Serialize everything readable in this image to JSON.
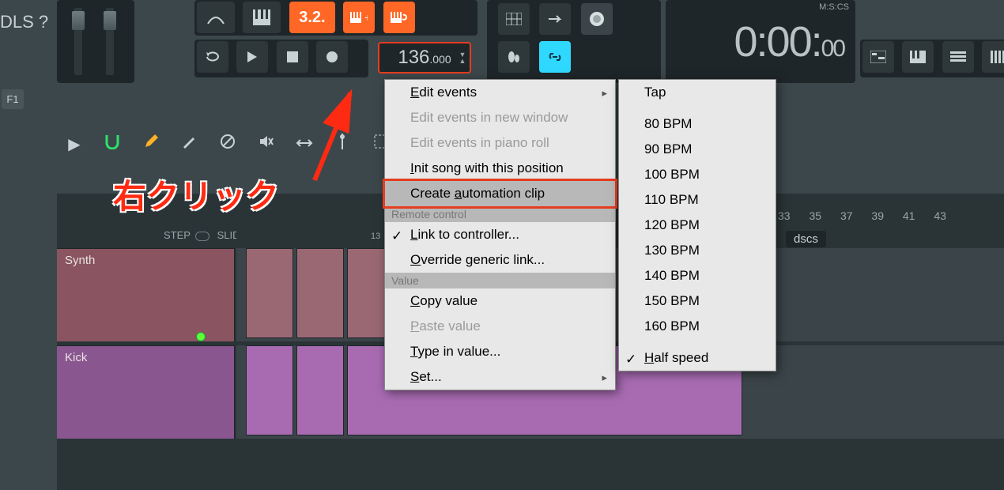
{
  "left": {
    "ols_text": "DLS ?",
    "f1": "F1"
  },
  "toolbar": {
    "pattern_num": "3.2.",
    "tempo_main": "136",
    "tempo_dec": ".000",
    "time_label": "M:S:CS",
    "time": "0:00:",
    "time_cs": "00"
  },
  "toolrow": {
    "step": "STEP",
    "slide": "SLIDE"
  },
  "timeline": {
    "nums": [
      "13",
      "33",
      "35",
      "37",
      "39",
      "41",
      "43"
    ]
  },
  "tracks": {
    "synth": "Synth",
    "kick": "Kick",
    "dscs": "dscs"
  },
  "anno": {
    "text": "右クリック"
  },
  "menu1": {
    "edit_events": "Edit events",
    "edit_events_new": "Edit events in new window",
    "edit_events_pr": "Edit events in piano roll",
    "init_song": "Init song with this position",
    "create_auto": "Create automation clip",
    "sect_remote": "Remote control",
    "link_ctrl": "Link to controller...",
    "override": "Override generic link...",
    "sect_value": "Value",
    "copy_val": "Copy value",
    "paste_val": "Paste value",
    "type_val": "Type in value...",
    "set": "Set..."
  },
  "menu2": {
    "tap": "Tap",
    "bpm": [
      "80 BPM",
      "90 BPM",
      "100 BPM",
      "110 BPM",
      "120 BPM",
      "130 BPM",
      "140 BPM",
      "150 BPM",
      "160 BPM"
    ],
    "half": "Half speed"
  }
}
